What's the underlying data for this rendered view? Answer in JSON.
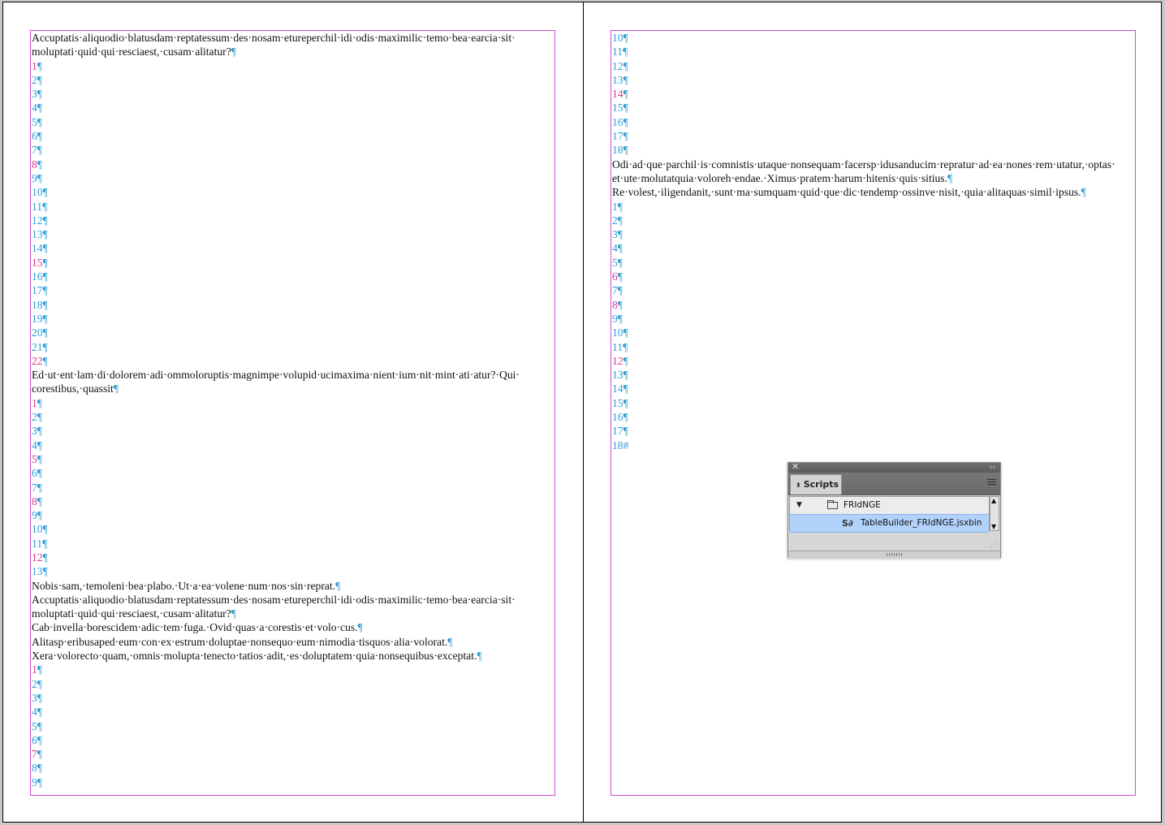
{
  "left_page": {
    "lines": [
      {
        "t": "p",
        "text": "Accuptatis·aliquodio·blatusdam·reptatessum·des·nosam·etureperchil·idi·odis·maximilic·temo·bea·earcia·sit·"
      },
      {
        "t": "p",
        "text": "moluptati·quid·qui·resciaest,·cusam·alitatur?",
        "end": "¶"
      },
      {
        "t": "n",
        "text": "1",
        "pink": true
      },
      {
        "t": "n",
        "text": "2"
      },
      {
        "t": "n",
        "text": "3"
      },
      {
        "t": "n",
        "text": "4"
      },
      {
        "t": "n",
        "text": "5"
      },
      {
        "t": "n",
        "text": "6"
      },
      {
        "t": "n",
        "text": "7"
      },
      {
        "t": "n",
        "text": "8",
        "pink": true
      },
      {
        "t": "n",
        "text": "9"
      },
      {
        "t": "n",
        "text": "10"
      },
      {
        "t": "n",
        "text": "11"
      },
      {
        "t": "n",
        "text": "12"
      },
      {
        "t": "n",
        "text": "13"
      },
      {
        "t": "n",
        "text": "14"
      },
      {
        "t": "n",
        "text": "15",
        "pink": true
      },
      {
        "t": "n",
        "text": "16"
      },
      {
        "t": "n",
        "text": "17"
      },
      {
        "t": "n",
        "text": "18"
      },
      {
        "t": "n",
        "text": "19"
      },
      {
        "t": "n",
        "text": "20"
      },
      {
        "t": "n",
        "text": "21"
      },
      {
        "t": "n",
        "text": "22",
        "pink": true
      },
      {
        "t": "p",
        "text": "Ed·ut·ent·lam·di·dolorem·adi·ommoloruptis·magnimpe·volupid·ucimaxima·nient·ium·nit·mint·ati·atur?·Qui·"
      },
      {
        "t": "p",
        "text": "corestibus,·quassit",
        "end": "¶"
      },
      {
        "t": "n",
        "text": "1",
        "pink": true
      },
      {
        "t": "n",
        "text": "2"
      },
      {
        "t": "n",
        "text": "3"
      },
      {
        "t": "n",
        "text": "4"
      },
      {
        "t": "n",
        "text": "5",
        "pink": true
      },
      {
        "t": "n",
        "text": "6"
      },
      {
        "t": "n",
        "text": "7"
      },
      {
        "t": "n",
        "text": "8",
        "pink": true
      },
      {
        "t": "n",
        "text": "9"
      },
      {
        "t": "n",
        "text": "10"
      },
      {
        "t": "n",
        "text": "11"
      },
      {
        "t": "n",
        "text": "12",
        "pink": true
      },
      {
        "t": "n",
        "text": "13"
      },
      {
        "t": "p",
        "text": "Nobis·sam,·temoleni·bea·plabo.·Ut·a·ea·volene·num·nos·sin·reprat.",
        "end": "¶"
      },
      {
        "t": "p",
        "text": "Accuptatis·aliquodio·blatusdam·reptatessum·des·nosam·etureperchil·idi·odis·maximilic·temo·bea·earcia·sit·"
      },
      {
        "t": "p",
        "text": "moluptati·quid·qui·resciaest,·cusam·alitatur?",
        "end": "¶"
      },
      {
        "t": "p",
        "text": "Cab·invella·borescidem·adic·tem·fuga.·Ovid·quas·a·corestis·et·volo·cus.",
        "end": "¶"
      },
      {
        "t": "p",
        "text": "Alitasp·eribusaped·eum·con·ex·estrum·doluptae·nonsequo·eum·nimodia·tisquos·alia·volorat.",
        "end": "¶"
      },
      {
        "t": "p",
        "text": "Xera·volorecto·quam,·omnis·molupta·tenecto·tatios·adit,·es·doluptatem·quia·nonsequibus·exceptat.",
        "end": "¶"
      },
      {
        "t": "n",
        "text": "1",
        "pink": true
      },
      {
        "t": "n",
        "text": "2"
      },
      {
        "t": "n",
        "text": "3"
      },
      {
        "t": "n",
        "text": "4"
      },
      {
        "t": "n",
        "text": "5"
      },
      {
        "t": "n",
        "text": "6"
      },
      {
        "t": "n",
        "text": "7",
        "pink": true
      },
      {
        "t": "n",
        "text": "8"
      },
      {
        "t": "n",
        "text": "9"
      }
    ]
  },
  "right_page": {
    "lines": [
      {
        "t": "n",
        "text": "10"
      },
      {
        "t": "n",
        "text": "11"
      },
      {
        "t": "n",
        "text": "12"
      },
      {
        "t": "n",
        "text": "13"
      },
      {
        "t": "n",
        "text": "14",
        "pink": true
      },
      {
        "t": "n",
        "text": "15"
      },
      {
        "t": "n",
        "text": "16"
      },
      {
        "t": "n",
        "text": "17"
      },
      {
        "t": "n",
        "text": "18"
      },
      {
        "t": "p",
        "text": "Odi·ad·que·parchil·is·comnistis·utaque·nonsequam·facersp·idusanducim·repratur·ad·ea·nones·rem·utatur,·optas·"
      },
      {
        "t": "p",
        "text": "et·ute·molutatquia·voloreh·endae.·Ximus·pratem·harum·hitenis·quis·sitius.",
        "end": "¶"
      },
      {
        "t": "p",
        "text": "Re·volest,·iligendanit,·sunt·ma·sumquam·quid·que·dic·tendemp·ossinve·nisit,·quia·alitaquas·simil·ipsus.",
        "end": "¶"
      },
      {
        "t": "n",
        "text": "1"
      },
      {
        "t": "n",
        "text": "2"
      },
      {
        "t": "n",
        "text": "3"
      },
      {
        "t": "n",
        "text": "4"
      },
      {
        "t": "n",
        "text": "5"
      },
      {
        "t": "n",
        "text": "6",
        "pink": true
      },
      {
        "t": "n",
        "text": "7"
      },
      {
        "t": "n",
        "text": "8",
        "pink": true
      },
      {
        "t": "n",
        "text": "9"
      },
      {
        "t": "n",
        "text": "10"
      },
      {
        "t": "n",
        "text": "11"
      },
      {
        "t": "n",
        "text": "12",
        "pink": true
      },
      {
        "t": "n",
        "text": "13"
      },
      {
        "t": "n",
        "text": "14"
      },
      {
        "t": "n",
        "text": "15"
      },
      {
        "t": "n",
        "text": "16"
      },
      {
        "t": "n",
        "text": "17"
      },
      {
        "t": "n",
        "text": "18",
        "endmark": "#"
      }
    ]
  },
  "pilcrow": "¶",
  "colors": {
    "frame": "#d24ad2",
    "marker_blue": "#2e9ed8",
    "marker_pink": "#d7398c",
    "selection": "#b2d2fb"
  },
  "scripts_panel": {
    "tab_label": "Scripts",
    "close_glyph": "✕",
    "collapse_glyph": "‹‹",
    "folder": {
      "label": "FRIdNGE",
      "icon": "folder-icon"
    },
    "script": {
      "label": "TableBuilder_FRIdNGE.jsxbin",
      "icon": "script-icon",
      "icon_glyph": "S∂"
    }
  }
}
